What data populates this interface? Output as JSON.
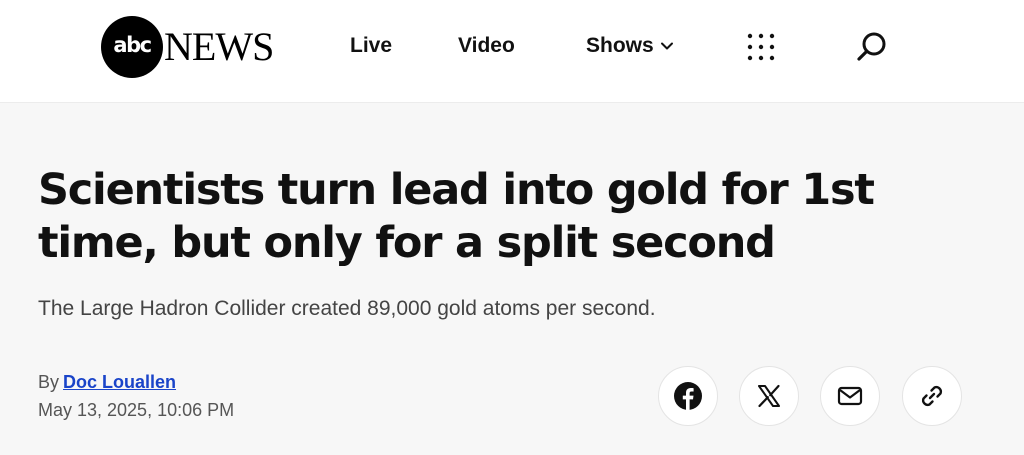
{
  "header": {
    "logo_circle": "abc",
    "logo_text": "NEWS",
    "nav": {
      "live": "Live",
      "video": "Video",
      "shows": "Shows"
    },
    "icons": [
      "chevron-down-icon",
      "grid-menu-icon",
      "search-icon"
    ]
  },
  "article": {
    "headline": "Scientists turn lead into gold for 1st time, but only for a split second",
    "subheadline": "The Large Hadron Collider created 89,000 gold atoms per second.",
    "byline_prefix": "By",
    "author": "Doc Louallen",
    "date": "May 13, 2025, 10:06 PM"
  },
  "share": {
    "icons": [
      "facebook-icon",
      "x-icon",
      "email-icon",
      "link-icon"
    ]
  },
  "colors": {
    "link": "#1a44c9",
    "background": "#f7f7f7",
    "header_bg": "#ffffff"
  }
}
